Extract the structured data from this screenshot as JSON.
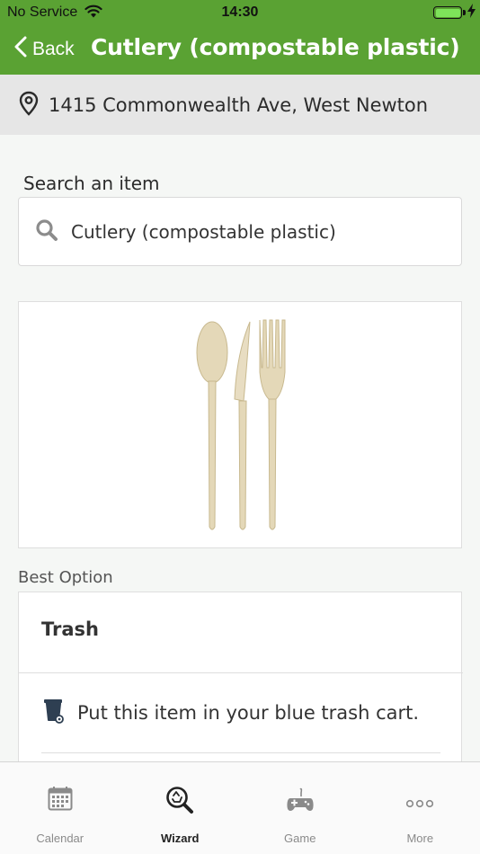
{
  "status": {
    "carrier": "No Service",
    "time": "14:30",
    "battery_level": 1.0
  },
  "nav": {
    "back_label": "Back",
    "title": "Cutlery (compostable plastic)"
  },
  "address": {
    "text": "1415 Commonwealth Ave, West Newton"
  },
  "search": {
    "label": "Search an item",
    "value": "Cutlery (compostable plastic)"
  },
  "best_option": {
    "section_label": "Best Option",
    "title": "Trash",
    "instruction": "Put this item in your blue trash cart."
  },
  "tabs": [
    {
      "label": "Calendar",
      "icon": "calendar-icon",
      "active": false
    },
    {
      "label": "Wizard",
      "icon": "wizard-search-icon",
      "active": true
    },
    {
      "label": "Game",
      "icon": "gamepad-icon",
      "active": false
    },
    {
      "label": "More",
      "icon": "more-dots-icon",
      "active": false
    }
  ],
  "colors": {
    "header_green": "#5aa233",
    "battery_green": "#7ee35a",
    "cart_blue": "#2e3f52"
  }
}
